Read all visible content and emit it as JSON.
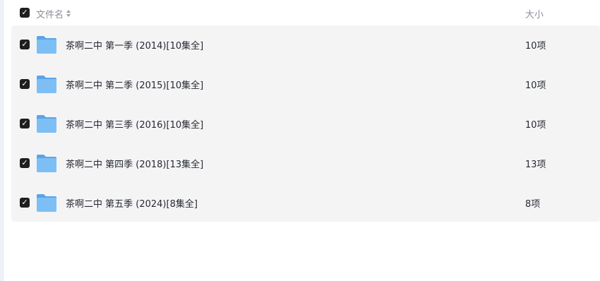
{
  "header": {
    "select_all_check": "✓",
    "name_column": "文件名",
    "size_column": "大小",
    "sort_icon": "sort-icon"
  },
  "colors": {
    "checkbox": "#1f1f1f",
    "row_bg": "#f4f4f5",
    "folder_blue": "#6ab0ee"
  },
  "rows": [
    {
      "name": "茶啊二中 第一季 (2014)[10集全]",
      "size": "10项",
      "checked": true,
      "icon": "folder-icon"
    },
    {
      "name": "茶啊二中 第二季 (2015)[10集全]",
      "size": "10项",
      "checked": true,
      "icon": "folder-icon"
    },
    {
      "name": "茶啊二中 第三季 (2016)[10集全]",
      "size": "10项",
      "checked": true,
      "icon": "folder-icon"
    },
    {
      "name": "茶啊二中 第四季 (2018)[13集全]",
      "size": "13项",
      "checked": true,
      "icon": "folder-icon"
    },
    {
      "name": "茶啊二中 第五季 (2024)[8集全]",
      "size": "8项",
      "checked": true,
      "icon": "folder-icon"
    }
  ]
}
